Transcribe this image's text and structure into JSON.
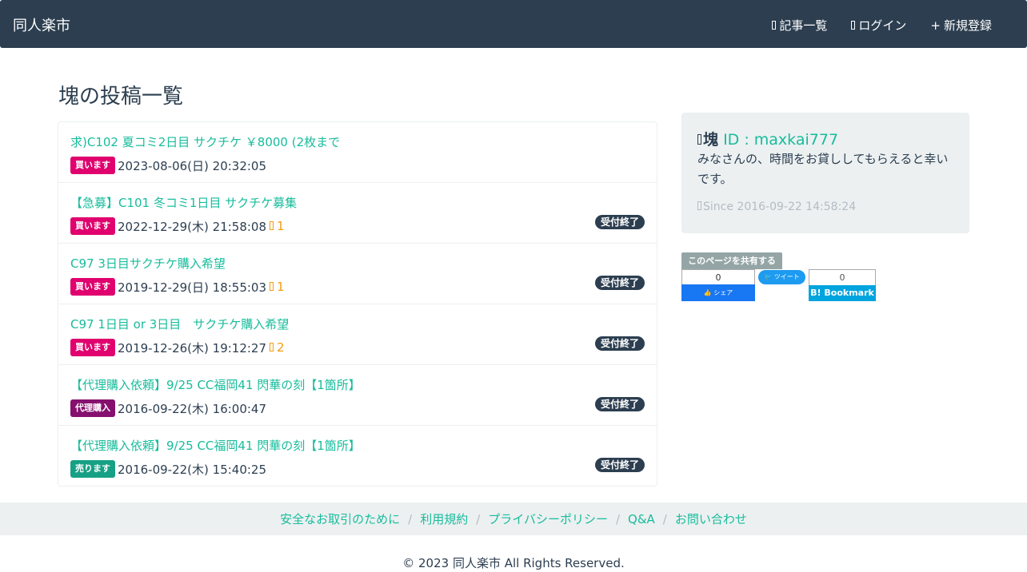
{
  "nav": {
    "brand": "同人楽市",
    "articles": "記事一覧",
    "login": "ログイン",
    "register_plus": "+",
    "register": "新規登録"
  },
  "page_title": "塊の投稿一覧",
  "posts": [
    {
      "title": "求)C102 夏コミ2日目 サクチケ ￥8000 (2枚まで",
      "badge": "買います",
      "date": "2023-08-06(日) 20:32:05",
      "fav": "",
      "status": ""
    },
    {
      "title": "【急募】C101 冬コミ1日目 サクチケ募集",
      "badge": "買います",
      "date": "2022-12-29(木) 21:58:08",
      "fav": "1",
      "status": "受付終了"
    },
    {
      "title": "C97 3日目サクチケ購入希望",
      "badge": "買います",
      "date": "2019-12-29(日) 18:55:03",
      "fav": "1",
      "status": "受付終了"
    },
    {
      "title": "C97 1日目 or 3日目　サクチケ購入希望",
      "badge": "買います",
      "date": "2019-12-26(木) 19:12:27",
      "fav": "2",
      "status": "受付終了"
    },
    {
      "title": "【代理購入依頼】9/25 CC福岡41 閃華の刻【1箇所】",
      "badge": "代理購入",
      "date": "2016-09-22(木) 16:00:47",
      "fav": "",
      "status": "受付終了"
    },
    {
      "title": "【代理購入依頼】9/25 CC福岡41 閃華の刻【1箇所】",
      "badge": "売ります",
      "date": "2016-09-22(木) 15:40:25",
      "fav": "",
      "status": "受付終了"
    }
  ],
  "profile": {
    "name": "塊",
    "id_text": "ID : maxkai777",
    "bio": "みなさんの、時間をお貸ししてもらえると幸いです。",
    "since": "Since 2016-09-22 14:58:24"
  },
  "share": {
    "label": "このページを共有する",
    "fb_count": "0",
    "fb_label": "シェア",
    "tw_label": "ツイート",
    "hb_count": "0",
    "hb_label": "B! Bookmark"
  },
  "footer": {
    "links": [
      "安全なお取引のために",
      "利用規約",
      "プライバシーポリシー",
      "Q&A",
      "お問い合わせ"
    ],
    "copyright": "© 2023 同人楽市 All Rights Reserved."
  },
  "colors": {
    "navbar": "#2c3e50",
    "link": "#18bc9c",
    "buy_badge": "#e0006e",
    "proxy_badge": "#85106e",
    "sell_badge": "#17a085",
    "closed_badge": "#2c3e50",
    "fav": "#f39c12"
  }
}
